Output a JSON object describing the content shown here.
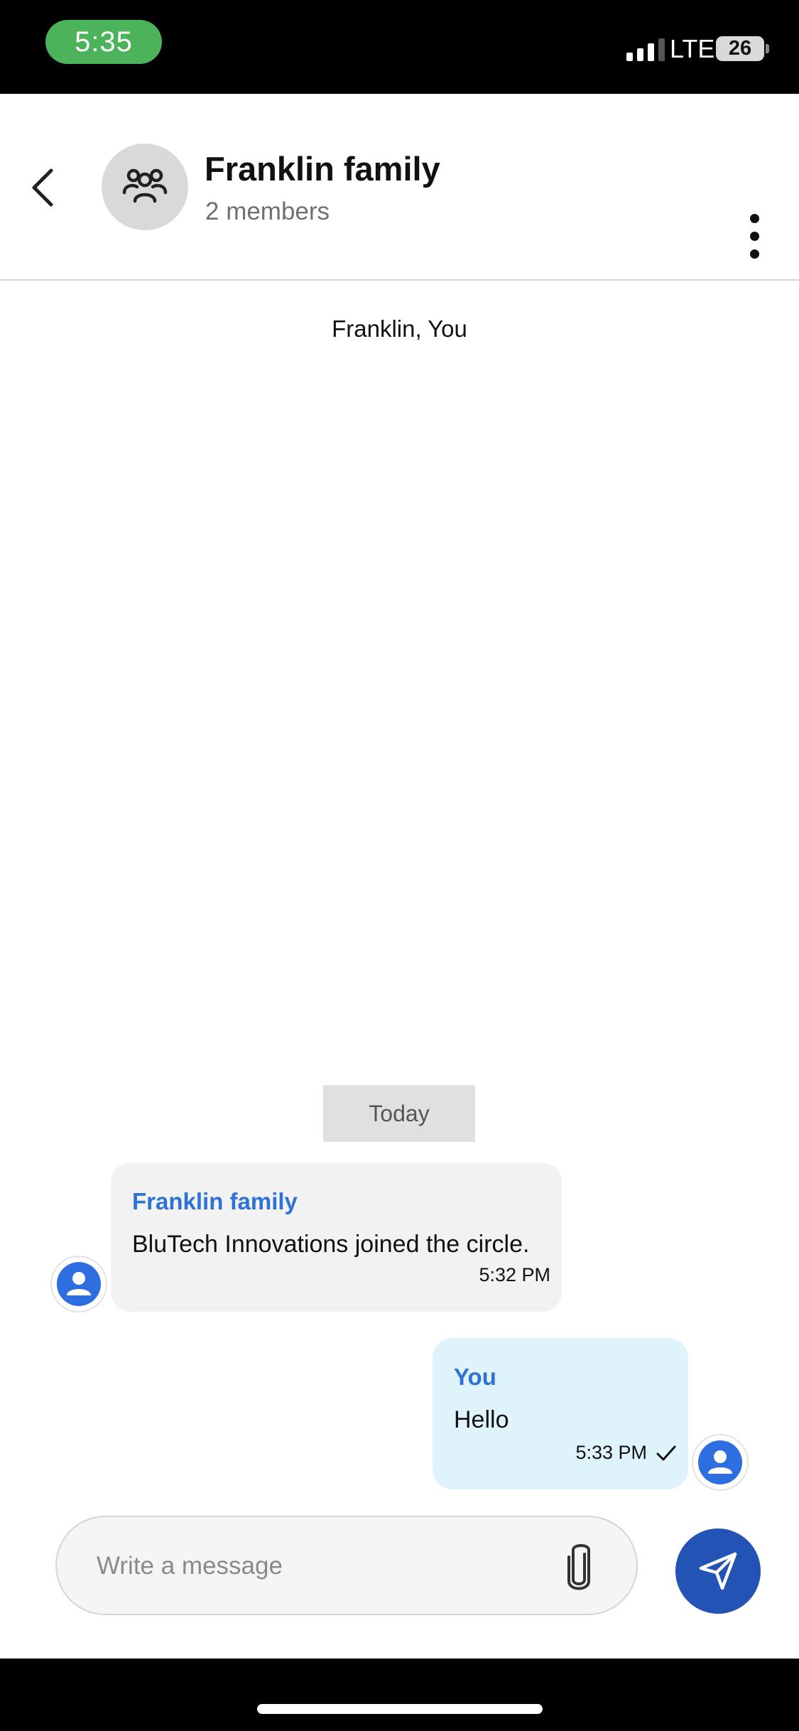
{
  "status_bar": {
    "time": "5:35",
    "network": "LTE",
    "battery": "26"
  },
  "header": {
    "back_icon": "chevron-left-icon",
    "avatar_icon": "group-icon",
    "title": "Franklin family",
    "subtitle": "2 members",
    "menu_icon": "more-vertical-icon"
  },
  "conversation": {
    "participants": "Franklin, You",
    "date_separator": "Today",
    "messages": [
      {
        "direction": "incoming",
        "sender": "Franklin family",
        "text": "BluTech Innovations joined the circle.",
        "time": "5:32 PM",
        "avatar_icon": "user-icon"
      },
      {
        "direction": "outgoing",
        "sender": "You",
        "text": "Hello",
        "time": "5:33 PM",
        "status_icon": "check-icon",
        "avatar_icon": "user-icon"
      }
    ]
  },
  "composer": {
    "placeholder": "Write a message",
    "value": "",
    "attach_icon": "paperclip-icon",
    "send_icon": "send-icon"
  },
  "colors": {
    "accent": "#2453b6",
    "sender_name": "#2f72d5",
    "incoming_bubble": "#f2f2f2",
    "outgoing_bubble": "#dff3fb",
    "status_time_pill": "#4cb35a"
  }
}
